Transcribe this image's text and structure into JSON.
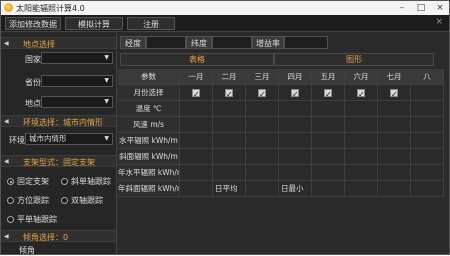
{
  "window": {
    "title": "太阳能辐照计算4.0",
    "minimize": "–",
    "maximize": "□",
    "close": "×"
  },
  "menu": {
    "items": [
      "添加修改数据",
      "模拟计算",
      "注册"
    ],
    "close": "×"
  },
  "sidebar": {
    "location": {
      "header": "地点选择",
      "country_label": "国家",
      "province_label": "省份",
      "place_label": "地点",
      "country_value": "",
      "province_value": "",
      "place_value": ""
    },
    "environment": {
      "header": "环境选择：城市内情形",
      "env_label": "环境",
      "env_value": "城市内情形"
    },
    "bracket": {
      "header": "支架型式：固定支架",
      "options": [
        "固定支架",
        "斜单轴跟踪",
        "方位跟踪",
        "双轴跟踪",
        "平单轴跟踪"
      ],
      "selected": "固定支架"
    },
    "tilt": {
      "header": "倾角选择：0",
      "angle_label": "倾角"
    }
  },
  "main": {
    "info": {
      "longitude_label": "经度",
      "latitude_label": "纬度",
      "gain_label": "增益率",
      "longitude_value": "",
      "latitude_value": "",
      "gain_value": ""
    },
    "tabs": [
      "表格",
      "图形"
    ],
    "table": {
      "param_header": "参数",
      "months": [
        "一月",
        "二月",
        "三月",
        "四月",
        "五月",
        "六月",
        "七月",
        "八"
      ],
      "rows": [
        "月份选择",
        "温度 ℃",
        "风速 m/s",
        "水平辐照 kWh/m",
        "斜面辐照 kWh/m",
        "年水平辐照 kWh/m",
        "年斜面辐照 kWh/m"
      ],
      "daily_avg": "日平均",
      "daily_min": "日最小"
    }
  }
}
